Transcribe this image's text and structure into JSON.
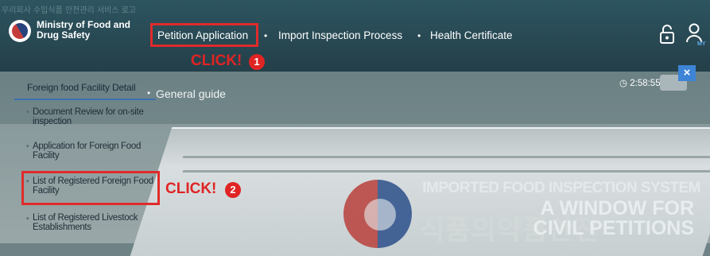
{
  "header": {
    "alt_text": "우리회사 수입식품 안전관리 서비스 로고",
    "logo_line1": "Ministry of Food and",
    "logo_line2": "Drug Safety",
    "nav": [
      "Petition Application",
      "Import Inspection Process",
      "Health Certificate"
    ],
    "nav_separator": "•",
    "lock_icon": "lock-icon",
    "user_icon": "user-icon",
    "user_badge": "MY"
  },
  "submenu": {
    "heading": "Foreign food Facility Detail",
    "general_guide": "General guide",
    "bullet": "•",
    "items": [
      "Document Review for on-site inspection",
      "Application for Foreign Food Facility",
      "List of Registered Foreign Food Facility",
      "List of Registered Livestock Establishments"
    ]
  },
  "session": {
    "timer": "2:58:55",
    "close_label": "×"
  },
  "annotations": {
    "click1": "CLICK!",
    "click1_num": "1",
    "click2": "CLICK!",
    "click2_num": "2",
    "highlight_color": "#e02b2b"
  },
  "hero": {
    "title": "IMPORTED FOOD INSPECTION SYSTEM",
    "subtitle_line1": "A WINDOW FOR",
    "subtitle_line2": "CIVIL PETITIONS",
    "building_lettering": "식품의약품안전"
  },
  "colors": {
    "topbar": "#2a4b56",
    "accent_blue": "#3d84d6"
  }
}
